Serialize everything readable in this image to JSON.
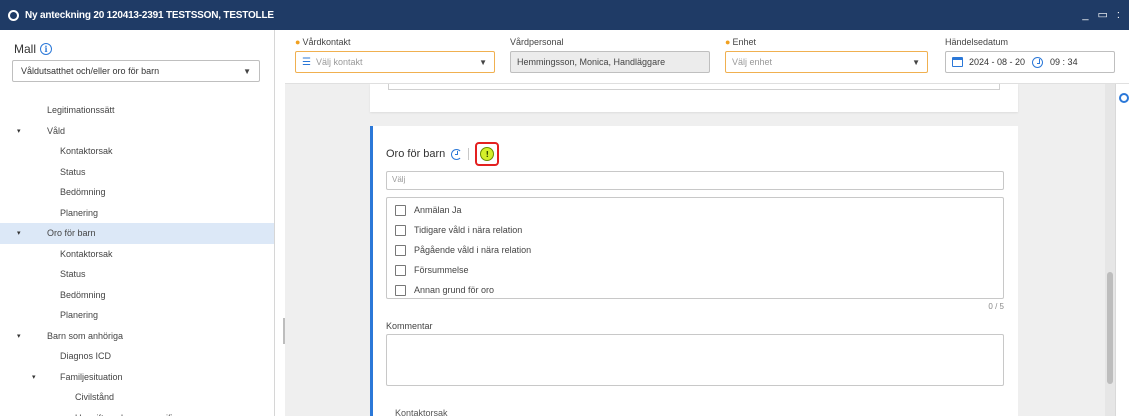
{
  "window": {
    "title": "Ny anteckning 20 120413-2391 TESTSSON, TESTOLLE",
    "controls": "_ ▭ :"
  },
  "sidebar": {
    "mall_label": "Mall",
    "mall_value": "Våldutsatthet och/eller oro för barn",
    "tree": [
      {
        "label": "Legitimationssätt",
        "level": 1,
        "toggle": ""
      },
      {
        "label": "Våld",
        "level": 1,
        "toggle": "▾"
      },
      {
        "label": "Kontaktorsak",
        "level": 2,
        "toggle": ""
      },
      {
        "label": "Status",
        "level": 2,
        "toggle": ""
      },
      {
        "label": "Bedömning",
        "level": 2,
        "toggle": ""
      },
      {
        "label": "Planering",
        "level": 2,
        "toggle": ""
      },
      {
        "label": "Oro för barn",
        "level": 1,
        "toggle": "▾",
        "selected": true
      },
      {
        "label": "Kontaktorsak",
        "level": 2,
        "toggle": ""
      },
      {
        "label": "Status",
        "level": 2,
        "toggle": ""
      },
      {
        "label": "Bedömning",
        "level": 2,
        "toggle": ""
      },
      {
        "label": "Planering",
        "level": 2,
        "toggle": ""
      },
      {
        "label": "Barn som anhöriga",
        "level": 1,
        "toggle": "▾"
      },
      {
        "label": "Diagnos ICD",
        "level": 2,
        "toggle": ""
      },
      {
        "label": "Familjesituation",
        "level": 2,
        "toggle": "▾"
      },
      {
        "label": "Civilstånd",
        "level": 3,
        "toggle": ""
      },
      {
        "label": "Uppgift om barn - specificeras u...",
        "level": 3,
        "toggle": ""
      }
    ]
  },
  "topbar": {
    "vardkontakt": {
      "label": "Vårdkontakt",
      "placeholder": "Välj kontakt"
    },
    "vardpersonal": {
      "label": "Vårdpersonal",
      "value": "Hemmingsson, Monica, Handläggare"
    },
    "enhet": {
      "label": "Enhet",
      "placeholder": "Välj enhet"
    },
    "handelsedatum": {
      "label": "Händelsedatum",
      "date": "2024 - 08 - 20",
      "time": "09 : 34"
    }
  },
  "card": {
    "title": "Oro för barn",
    "search_placeholder": "Välj",
    "options": [
      "Anmälan Ja",
      "Tidigare våld i nära relation",
      "Pågående våld i nära relation",
      "Försummelse",
      "Annan grund för oro"
    ],
    "counter": "0 / 5",
    "kommentar_label": "Kommentar",
    "next_section": "Kontaktorsak"
  },
  "colors": {
    "titlebar": "#1f3b66",
    "accent": "#2b78d8",
    "highlight_border": "#e32020",
    "alert_icon": "#d4ef2a"
  }
}
